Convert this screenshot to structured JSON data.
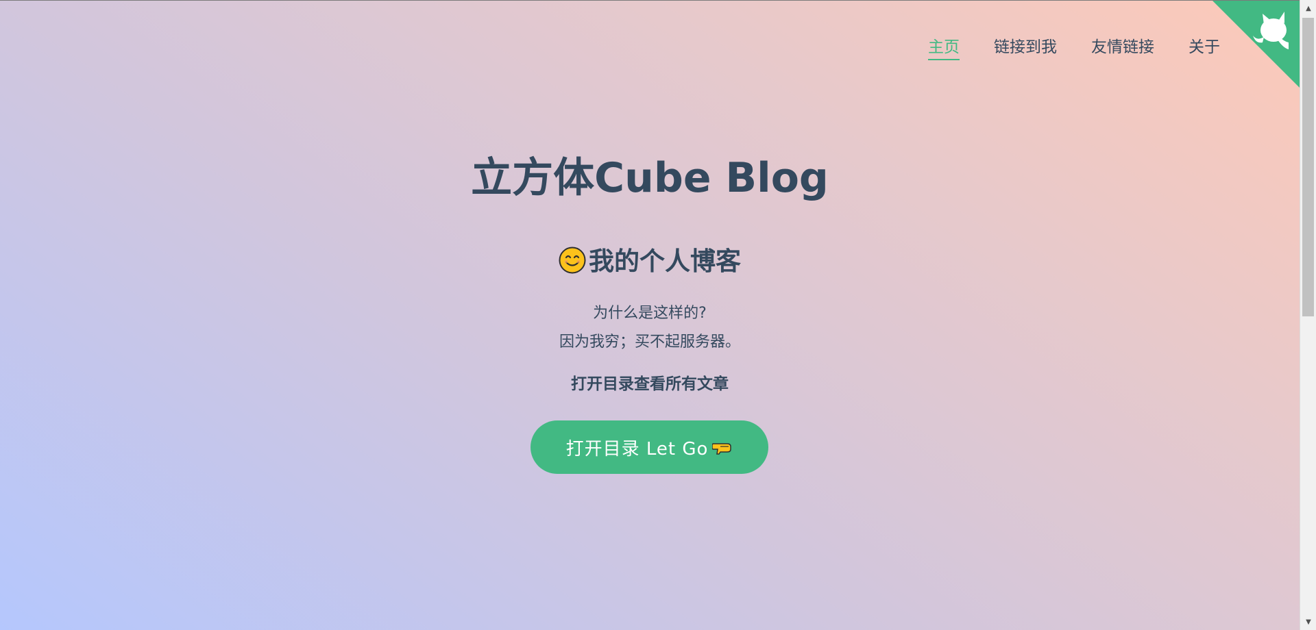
{
  "nav": {
    "items": [
      {
        "label": "主页",
        "active": true
      },
      {
        "label": "链接到我",
        "active": false
      },
      {
        "label": "友情链接",
        "active": false
      },
      {
        "label": "关于",
        "active": false
      }
    ]
  },
  "corner": {
    "icon": "github-octocat-icon",
    "color": "#42b983"
  },
  "cover": {
    "title_cn": "立方体",
    "title_en": "Cube Blog",
    "subtitle_emoji": "smiling-face-icon",
    "subtitle": "我的个人博客",
    "desc_line1": "为什么是这样的?",
    "desc_line2": "因为我穷；买不起服务器。",
    "toc_hint": "打开目录查看所有文章",
    "button_label": "打开目录 Let Go",
    "button_icon": "backhand-pointing-left-icon"
  },
  "theme": {
    "accent": "#42b983",
    "text": "#34495e"
  }
}
